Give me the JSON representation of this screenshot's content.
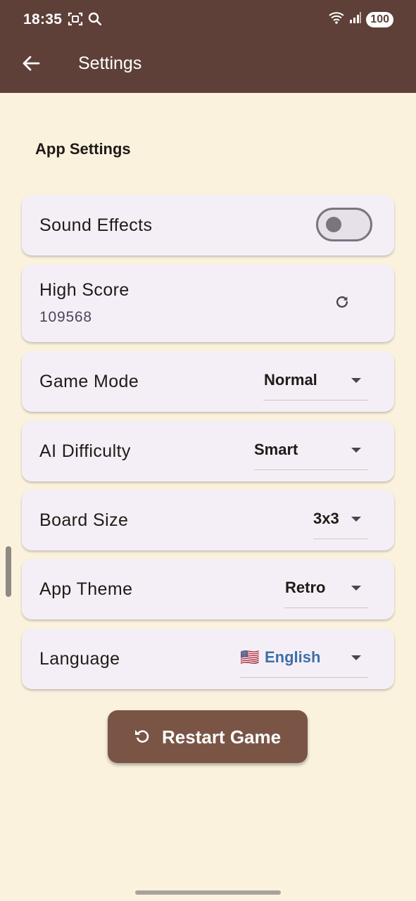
{
  "status_bar": {
    "time": "18:35",
    "battery": "100",
    "left_icons": [
      "screenshot-icon",
      "search-icon"
    ],
    "right_icons": [
      "wifi-icon",
      "signal-icon"
    ]
  },
  "app_bar": {
    "title": "Settings",
    "back_icon": "arrow-back-icon",
    "background": "#5E4039"
  },
  "section": {
    "title": "App Settings"
  },
  "settings": {
    "sound_effects": {
      "label": "Sound Effects",
      "enabled": false
    },
    "high_score": {
      "label": "High Score",
      "value": "109568",
      "action_icon": "refresh-icon"
    },
    "game_mode": {
      "label": "Game Mode",
      "value": "Normal"
    },
    "ai_difficulty": {
      "label": "AI Difficulty",
      "value": "Smart"
    },
    "board_size": {
      "label": "Board Size",
      "value": "3x3"
    },
    "app_theme": {
      "label": "App Theme",
      "value": "Retro"
    },
    "language": {
      "label": "Language",
      "flag": "🇺🇸",
      "value": "English"
    }
  },
  "restart_button": {
    "label": "Restart Game",
    "icon": "restart-icon",
    "color": "#7A5546"
  },
  "colors": {
    "background": "#FAF2DD",
    "card": "#F4EFF7",
    "accent_language": "#3D6FA8"
  }
}
